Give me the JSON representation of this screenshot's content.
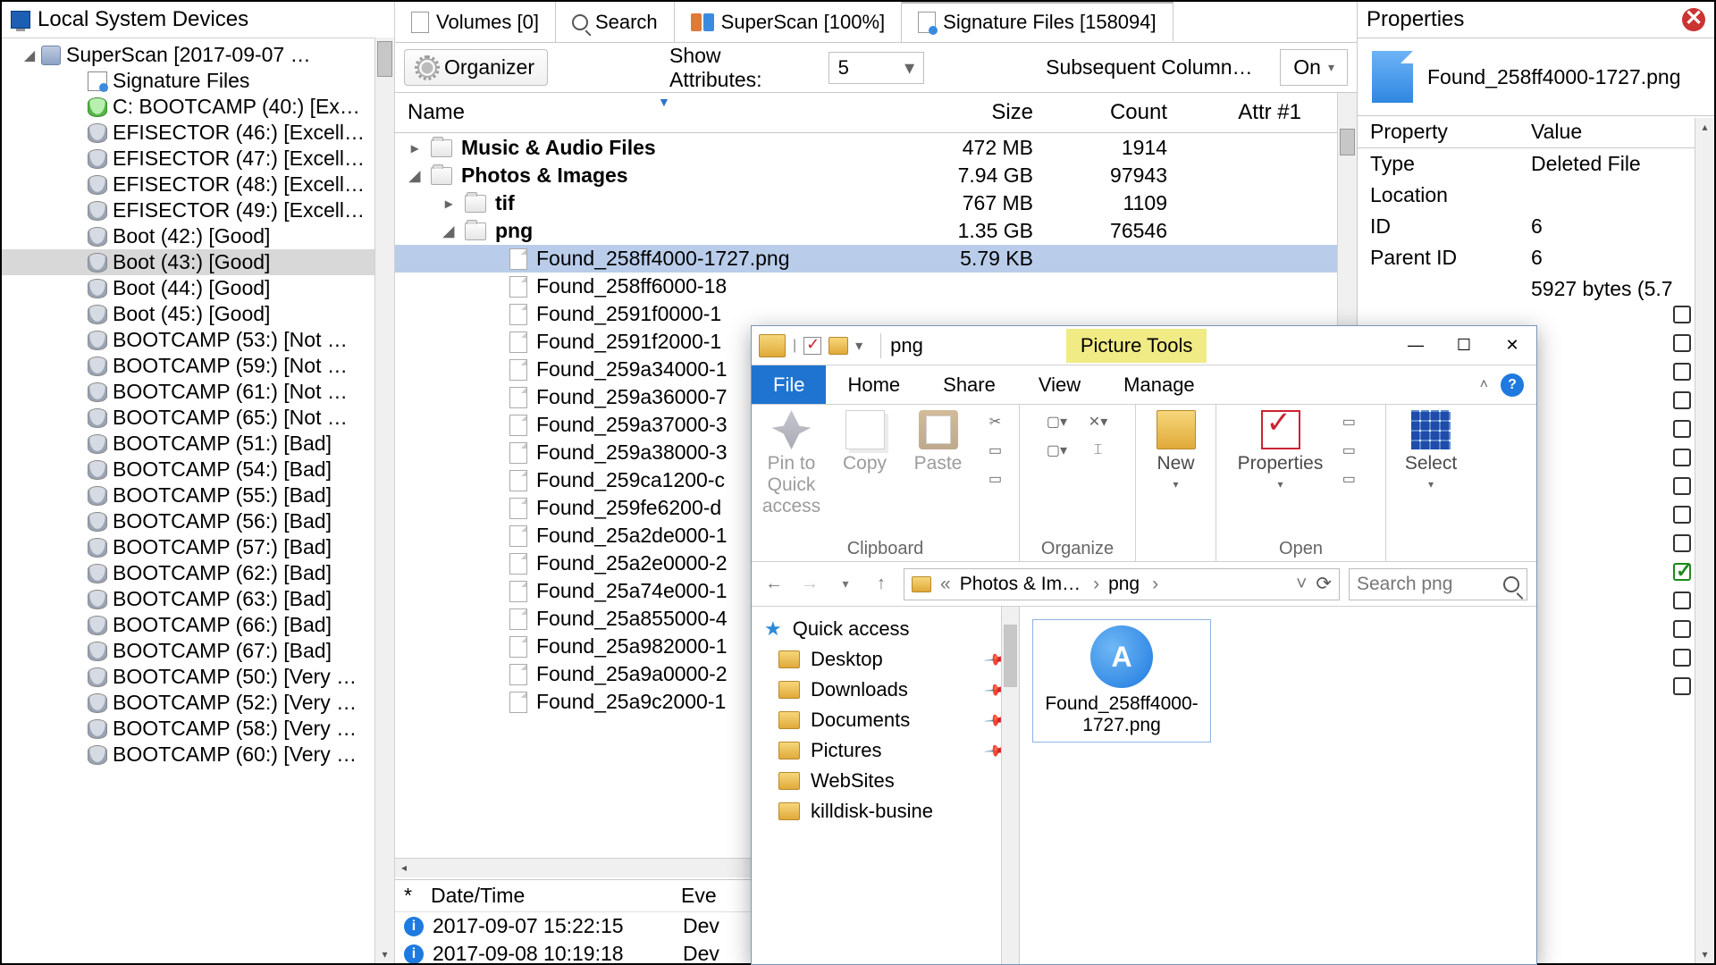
{
  "tree": {
    "header": "Local System Devices",
    "root": "SuperScan [2017-09-07 …",
    "signature": "Signature Files",
    "items": [
      "C: BOOTCAMP (40:) [Ex…",
      "EFISECTOR (46:) [Excell…",
      "EFISECTOR (47:) [Excell…",
      "EFISECTOR (48:) [Excell…",
      "EFISECTOR (49:) [Excell…",
      "Boot (42:) [Good]",
      "Boot (43:) [Good]",
      "Boot (44:) [Good]",
      "Boot (45:) [Good]",
      "BOOTCAMP (53:) [Not …",
      "BOOTCAMP (59:) [Not …",
      "BOOTCAMP (61:) [Not …",
      "BOOTCAMP (65:) [Not …",
      "BOOTCAMP (51:) [Bad]",
      "BOOTCAMP (54:) [Bad]",
      "BOOTCAMP (55:) [Bad]",
      "BOOTCAMP (56:) [Bad]",
      "BOOTCAMP (57:) [Bad]",
      "BOOTCAMP (62:) [Bad]",
      "BOOTCAMP (63:) [Bad]",
      "BOOTCAMP (66:) [Bad]",
      "BOOTCAMP (67:) [Bad]",
      "BOOTCAMP (50:) [Very …",
      "BOOTCAMP (52:) [Very …",
      "BOOTCAMP (58:) [Very …",
      "BOOTCAMP (60:) [Very …"
    ]
  },
  "tabs": {
    "volumes": "Volumes [0]",
    "search": "Search",
    "superscan": "SuperScan [100%]",
    "sigfiles": "Signature Files [158094]"
  },
  "toolbar": {
    "organizer": "Organizer",
    "show_attr": "Show Attributes:",
    "attr_value": "5",
    "subsequent": "Subsequent Column Se",
    "on": "On"
  },
  "cols": {
    "name": "Name",
    "size": "Size",
    "count": "Count",
    "attr": "Attr #1"
  },
  "rows": {
    "music": {
      "name": "Music & Audio Files",
      "size": "472 MB",
      "count": "1914"
    },
    "photos": {
      "name": "Photos & Images",
      "size": "7.94 GB",
      "count": "97943"
    },
    "tif": {
      "name": "tif",
      "size": "767 MB",
      "count": "1109"
    },
    "png": {
      "name": "png",
      "size": "1.35 GB",
      "count": "76546"
    },
    "selected": {
      "name": "Found_258ff4000-1727.png",
      "size": "5.79 KB"
    },
    "files": [
      "Found_258ff6000-18",
      "Found_2591f0000-1",
      "Found_2591f2000-1",
      "Found_259a34000-1",
      "Found_259a36000-7",
      "Found_259a37000-3",
      "Found_259a38000-3",
      "Found_259ca1200-c",
      "Found_259fe6200-d",
      "Found_25a2de000-1",
      "Found_25a2e0000-2",
      "Found_25a74e000-1",
      "Found_25a855000-4",
      "Found_25a982000-1",
      "Found_25a9a0000-2",
      "Found_25a9c2000-1"
    ]
  },
  "log": {
    "star": "*",
    "datetime": "Date/Time",
    "event": "Eve",
    "r1": {
      "dt": "2017-09-07 15:22:15",
      "ev": "Dev"
    },
    "r2": {
      "dt": "2017-09-08 10:19:18",
      "ev": "Dev"
    }
  },
  "props": {
    "title": "Properties",
    "filename": "Found_258ff4000-1727.png",
    "head_prop": "Property",
    "head_val": "Value",
    "rows": [
      {
        "k": "Type",
        "v": "Deleted File"
      },
      {
        "k": "Location",
        "v": ""
      },
      {
        "k": "ID",
        "v": "6"
      },
      {
        "k": "Parent ID",
        "v": "6"
      },
      {
        "k": "",
        "v": "5927 bytes (5.7"
      }
    ]
  },
  "explorer": {
    "title": "png",
    "ptools": "Picture Tools",
    "tabs": {
      "file": "File",
      "home": "Home",
      "share": "Share",
      "view": "View",
      "manage": "Manage"
    },
    "ribbon": {
      "pin": "Pin to Quick access",
      "copy": "Copy",
      "paste": "Paste",
      "clipboard": "Clipboard",
      "organize": "Organize",
      "new": "New",
      "properties": "Properties",
      "open": "Open",
      "select": "Select"
    },
    "crumb1": "Photos & Im…",
    "crumb2": "png",
    "search_ph": "Search png",
    "nav": {
      "qa": "Quick access",
      "desktop": "Desktop",
      "downloads": "Downloads",
      "documents": "Documents",
      "pictures": "Pictures",
      "websites": "WebSites",
      "killdisk": "killdisk-busine"
    },
    "thumb": "Found_258ff4000-1727.png"
  }
}
